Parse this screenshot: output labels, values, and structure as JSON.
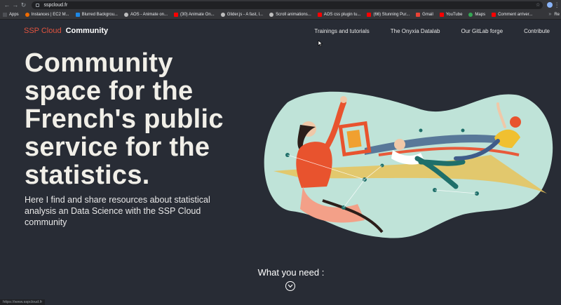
{
  "browser": {
    "url": "sspcloud.fr",
    "bookmarks": [
      {
        "label": "Apps",
        "icon": "apps"
      },
      {
        "label": "Instances | EC2 M...",
        "icon": "orange"
      },
      {
        "label": "Blurred Backgrou...",
        "icon": "blue"
      },
      {
        "label": "AOS - Animate on...",
        "icon": "grey"
      },
      {
        "label": "(30) Animate On...",
        "icon": "yt"
      },
      {
        "label": "Glider.js - A fast, l...",
        "icon": "grey"
      },
      {
        "label": "Scroll animations...",
        "icon": "grey"
      },
      {
        "label": "AOS css plugin tu...",
        "icon": "yt"
      },
      {
        "label": "(66) Stunning Pur...",
        "icon": "yt"
      },
      {
        "label": "Gmail",
        "icon": "gmail"
      },
      {
        "label": "YouTube",
        "icon": "yt"
      },
      {
        "label": "Maps",
        "icon": "map"
      },
      {
        "label": "Comment arriver...",
        "icon": "yt"
      }
    ],
    "more": "»",
    "reading_list": "Re",
    "status_text": "https://www.sspcloud.fr"
  },
  "header": {
    "brand_part1": "SSP Cloud",
    "brand_part2": "Community",
    "nav": [
      "Trainings and tutorials",
      "The Onyxia Datalab",
      "Our GitLab forge",
      "Contribute"
    ]
  },
  "hero": {
    "title": "Community space for the French's public service for the statistics.",
    "subtitle": "Here I find and share resources about statistical analysis an Data Science with the SSP Cloud community"
  },
  "footer_cta": {
    "label": "What you need :"
  },
  "colors": {
    "background": "#282c35",
    "brand_accent": "#e1543f",
    "blob": "#bfe3d8"
  }
}
